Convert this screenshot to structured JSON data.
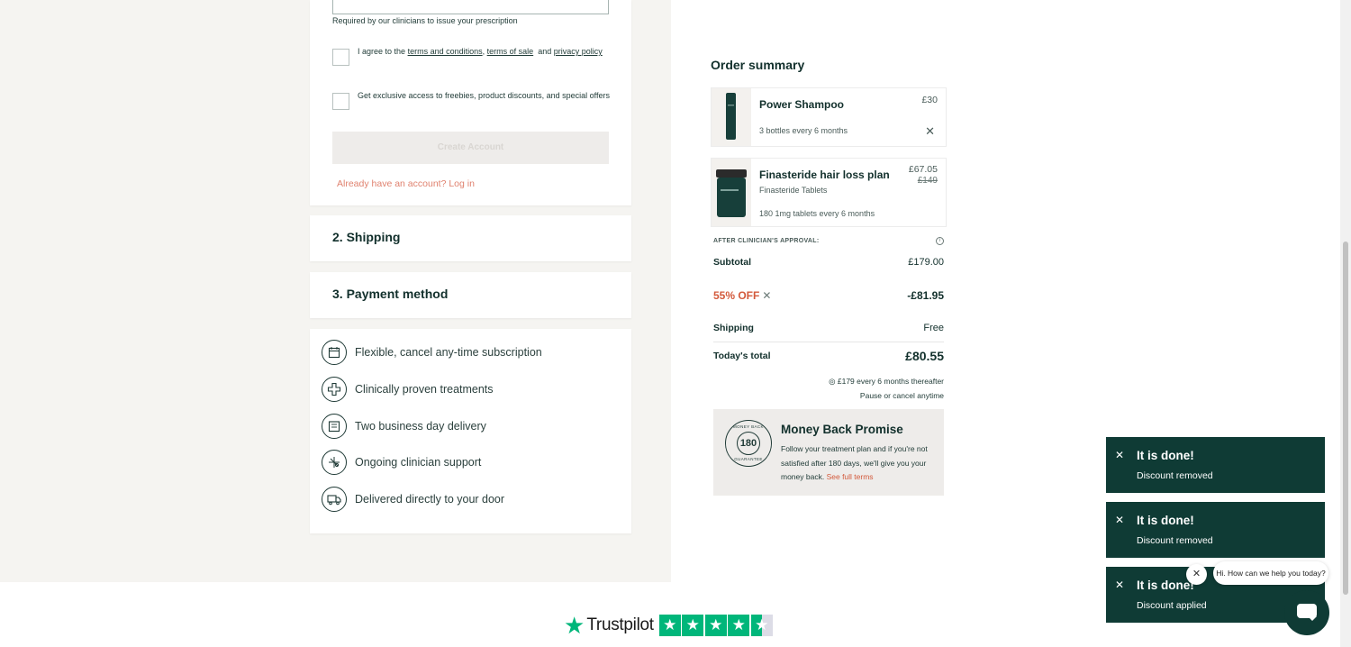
{
  "colors": {
    "brand_dark": "#0f3b35",
    "accent_red": "#d35a3c",
    "link_salmon": "#e0826f",
    "trustpilot_green": "#00b67a"
  },
  "account_form": {
    "hint": "Required by our clinicians to issue your prescription",
    "terms_prefix": "I agree to the",
    "terms_link": "terms and conditions",
    "terms_sep": ",",
    "sale_link": "terms of sale",
    "terms_and": "and",
    "privacy_link": "privacy policy",
    "marketing_text": "Get exclusive access to freebies, product discounts, and special offers",
    "create_button": "Create Account",
    "login_link": "Already have an account? Log in"
  },
  "steps": {
    "shipping": "2. Shipping",
    "payment": "3. Payment method"
  },
  "benefits": [
    {
      "icon": "calendar-icon",
      "label": "Flexible, cancel any-time subscription"
    },
    {
      "icon": "medical-cross-icon",
      "label": "Clinically proven treatments"
    },
    {
      "icon": "package-icon",
      "label": "Two business day delivery"
    },
    {
      "icon": "clinician-icon",
      "label": "Ongoing clinician support"
    },
    {
      "icon": "truck-icon",
      "label": "Delivered directly to your door"
    }
  ],
  "summary": {
    "title": "Order summary",
    "products": [
      {
        "name": "Power Shampoo",
        "price": "£30",
        "plan": "3 bottles every 6 months"
      },
      {
        "name": "Finasteride hair loss plan",
        "subtitle": "Finasteride Tablets",
        "price": "£67.05",
        "old_price": "£149",
        "plan": "180 1mg tablets every 6 months"
      }
    ],
    "after_approval": "AFTER CLINICIAN'S APPROVAL:",
    "subtotal_label": "Subtotal",
    "subtotal_value": "£179.00",
    "discount_label": "55% OFF",
    "discount_value": "-£81.95",
    "shipping_label": "Shipping",
    "shipping_value": "Free",
    "total_label": "Today's total",
    "total_value": "£80.55",
    "thereafter": "£179 every 6 months thereafter",
    "pause": "Pause or cancel anytime"
  },
  "money_back": {
    "seal_top": "MONEY BACK",
    "seal_days": "180",
    "seal_bottom": "GUARANTEE",
    "title": "Money Back Promise",
    "text": "Follow your treatment plan and if you're not satisfied after 180 days, we'll give you your money back.",
    "link": "See full terms"
  },
  "toasts": [
    {
      "title": "It is done!",
      "message": "Discount removed"
    },
    {
      "title": "It is done!",
      "message": "Discount removed"
    },
    {
      "title": "It is done!",
      "message": "Discount applied"
    }
  ],
  "chat": {
    "greeting": "Hi. How can we help you today?"
  },
  "trustpilot": {
    "brand": "Trustpilot"
  }
}
